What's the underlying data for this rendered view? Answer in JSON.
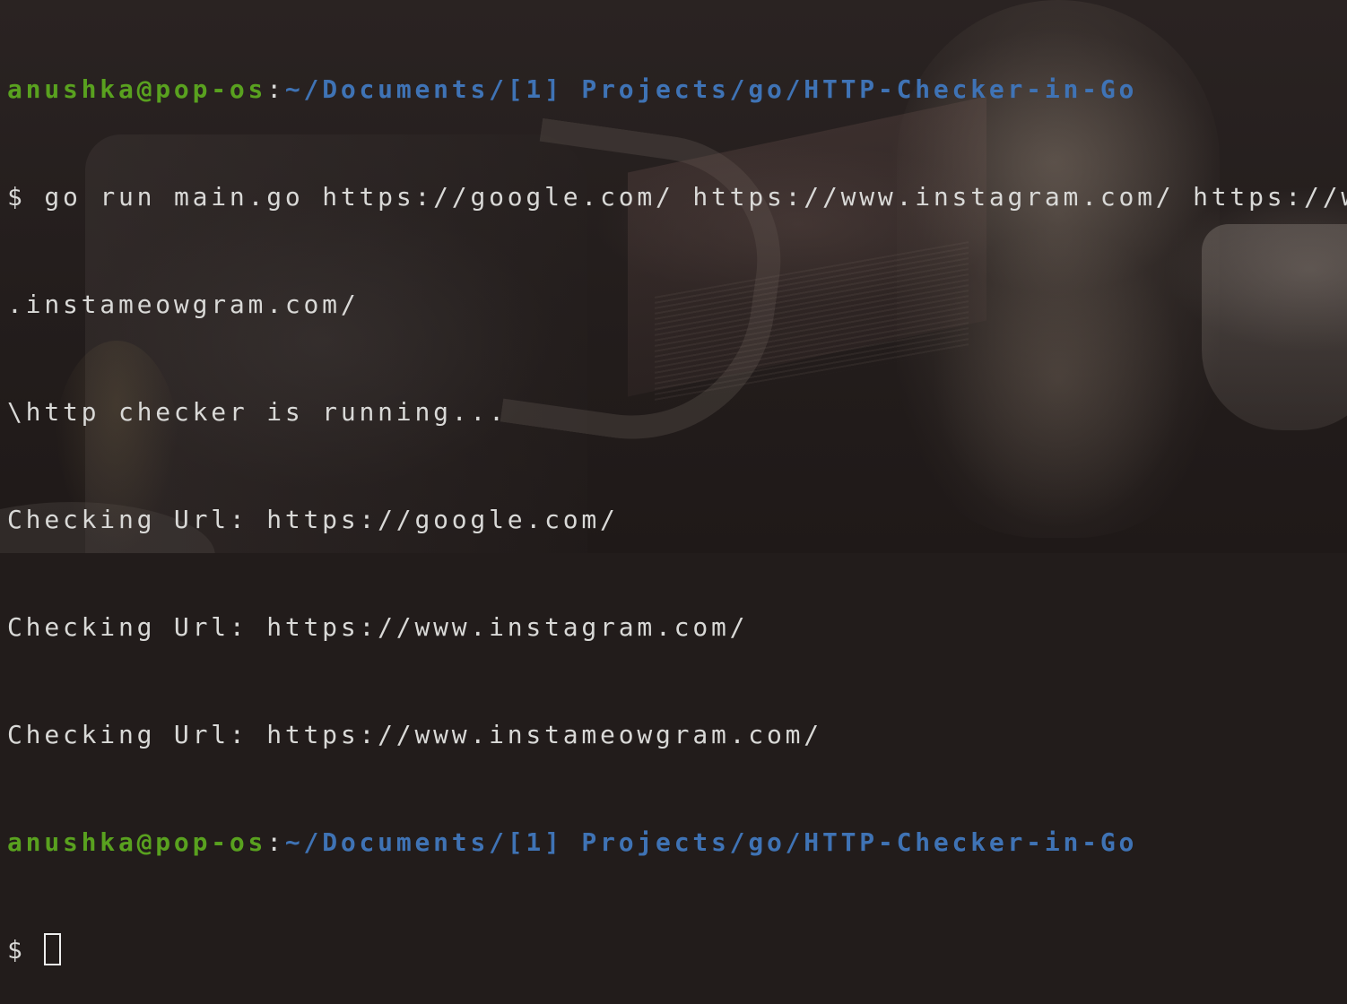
{
  "prompt_1": {
    "user_host": "anushka@pop-os",
    "separator": ":",
    "path": "~/Documents/[1] Projects/go/HTTP-Checker-in-Go"
  },
  "command": {
    "symbol": "$",
    "text": "go run main.go https://google.com/ https://www.instagram.com/ https://www",
    "wrapped": ".instameowgram.com/"
  },
  "output": [
    "\\http checker is running...",
    "Checking Url: https://google.com/",
    "Checking Url: https://www.instagram.com/",
    "Checking Url: https://www.instameowgram.com/"
  ],
  "prompt_2": {
    "user_host": "anushka@pop-os",
    "separator": ":",
    "path": "~/Documents/[1] Projects/go/HTTP-Checker-in-Go",
    "symbol": "$"
  },
  "colors": {
    "user_host": "#59a11f",
    "path": "#3f73b5",
    "text": "#d9d9d7"
  }
}
